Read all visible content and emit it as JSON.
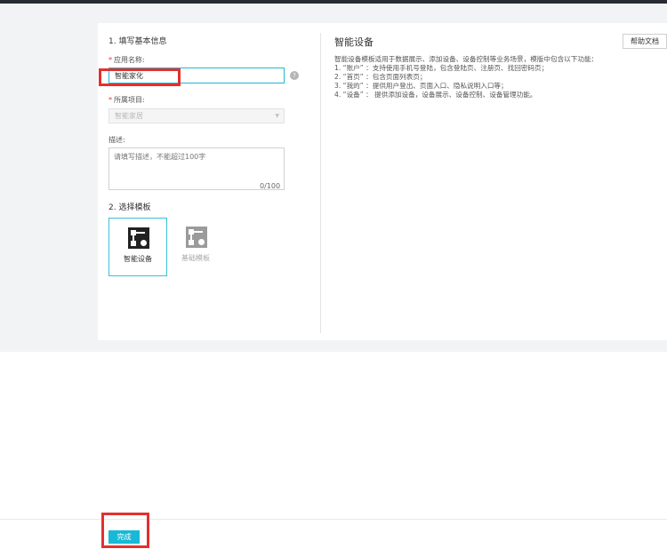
{
  "form": {
    "step1_title": "1. 填写基本信息",
    "app_name_label": "应用名称:",
    "app_name_value": "智能家化",
    "required_mark": "*",
    "help_icon": "?",
    "project_label": "所属项目:",
    "project_value": "智能家居",
    "desc_label": "描述:",
    "desc_placeholder": "请填写描述，不能超过100字",
    "desc_counter": "0/100",
    "step2_title": "2. 选择模板"
  },
  "templates": [
    {
      "label": "智能设备",
      "selected": true,
      "icon": "smart-device-icon"
    },
    {
      "label": "基础模板",
      "selected": false,
      "icon": "basic-template-icon"
    }
  ],
  "side": {
    "title": "智能设备",
    "help_button": "帮助文档",
    "lines": [
      "智能设备模板适用于数据展示、添加设备、设备控制等业务场景，模版中包含以下功能：",
      "1. “账户” ：支持使用手机号登陆，包含登陆页、注册页、找回密码页；",
      "2. “首页” ：包含页面列表页；",
      "3. “我的” ：提供用户登出、页面入口、隐私说明入口等；",
      "4. “设备” ： 提供添加设备，设备展示、设备控制、设备管理功能。"
    ]
  },
  "footer": {
    "done_label": "完成"
  },
  "colors": {
    "accent": "#17b9d6",
    "annotation": "#e3302e",
    "topbar": "#262a33"
  }
}
